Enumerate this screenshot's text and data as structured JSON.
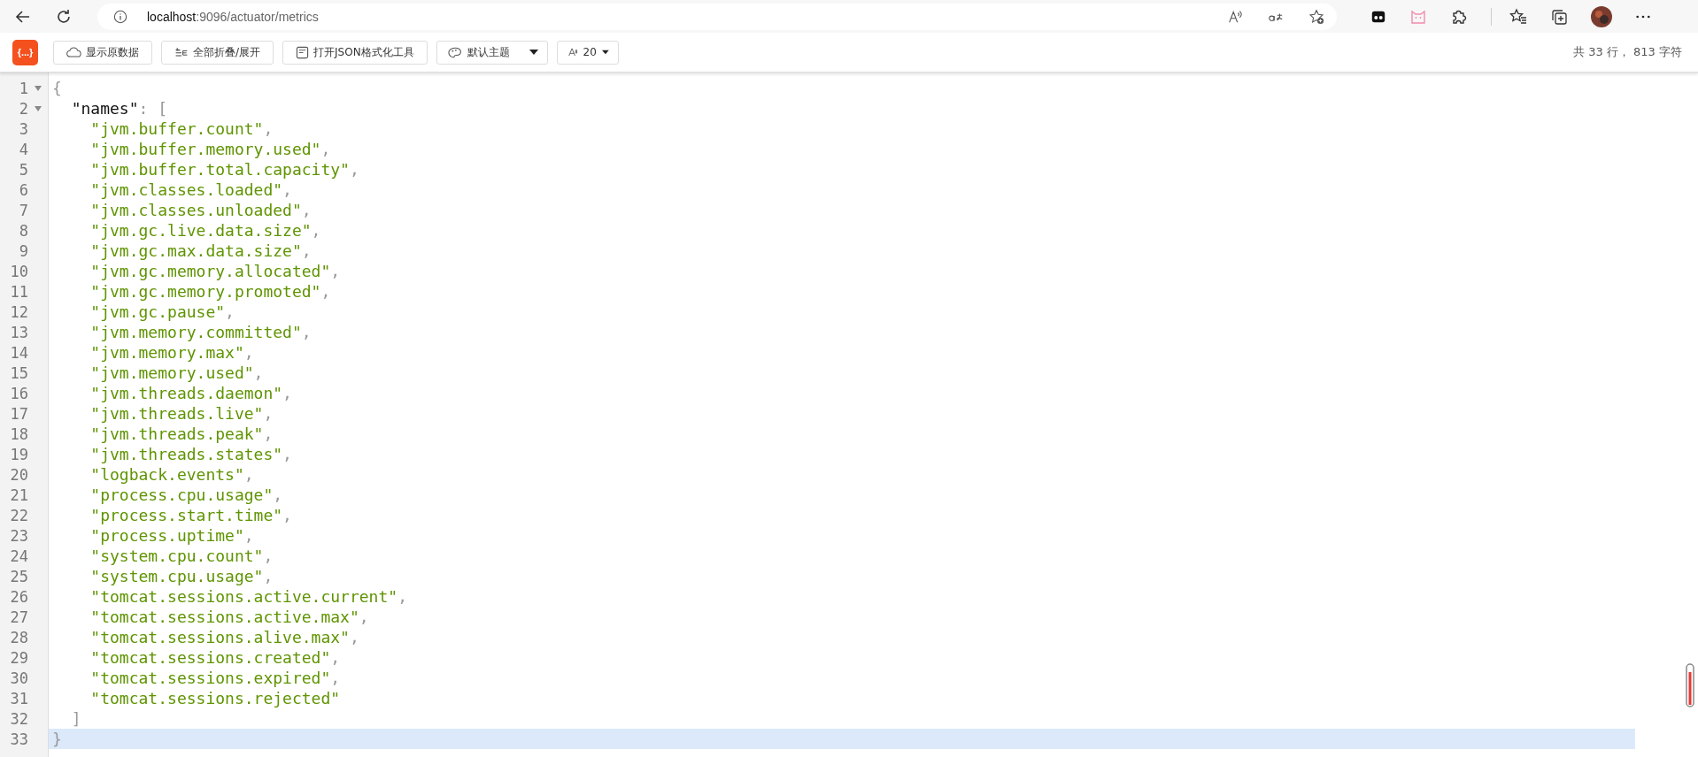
{
  "browser": {
    "url_host": "localhost",
    "url_path": ":9096/actuator/metrics"
  },
  "toolbar": {
    "logo": "{...}",
    "buttons": [
      {
        "kind": "raw",
        "label": "显示原数据"
      },
      {
        "kind": "fold",
        "label": "全部折叠/展开"
      },
      {
        "kind": "tool",
        "label": "打开JSON格式化工具"
      }
    ],
    "theme_select": {
      "value": "默认主题"
    },
    "font_select": {
      "value": "20"
    },
    "stats": "共 33 行， 813 字符"
  },
  "editor": {
    "lines": [
      {
        "number": "1",
        "foldable": true,
        "active": false,
        "tokens": [
          {
            "kind": "punct",
            "text": "{"
          }
        ]
      },
      {
        "number": "2",
        "foldable": true,
        "active": false,
        "tokens": [
          {
            "kind": "key",
            "text": "  \"names\""
          },
          {
            "kind": "punct",
            "text": ": ["
          }
        ]
      },
      {
        "number": "3",
        "foldable": false,
        "active": false,
        "tokens": [
          {
            "kind": "string",
            "text": "    \"jvm.buffer.count\""
          },
          {
            "kind": "punct",
            "text": ","
          }
        ]
      },
      {
        "number": "4",
        "foldable": false,
        "active": false,
        "tokens": [
          {
            "kind": "string",
            "text": "    \"jvm.buffer.memory.used\""
          },
          {
            "kind": "punct",
            "text": ","
          }
        ]
      },
      {
        "number": "5",
        "foldable": false,
        "active": false,
        "tokens": [
          {
            "kind": "string",
            "text": "    \"jvm.buffer.total.capacity\""
          },
          {
            "kind": "punct",
            "text": ","
          }
        ]
      },
      {
        "number": "6",
        "foldable": false,
        "active": false,
        "tokens": [
          {
            "kind": "string",
            "text": "    \"jvm.classes.loaded\""
          },
          {
            "kind": "punct",
            "text": ","
          }
        ]
      },
      {
        "number": "7",
        "foldable": false,
        "active": false,
        "tokens": [
          {
            "kind": "string",
            "text": "    \"jvm.classes.unloaded\""
          },
          {
            "kind": "punct",
            "text": ","
          }
        ]
      },
      {
        "number": "8",
        "foldable": false,
        "active": false,
        "tokens": [
          {
            "kind": "string",
            "text": "    \"jvm.gc.live.data.size\""
          },
          {
            "kind": "punct",
            "text": ","
          }
        ]
      },
      {
        "number": "9",
        "foldable": false,
        "active": false,
        "tokens": [
          {
            "kind": "string",
            "text": "    \"jvm.gc.max.data.size\""
          },
          {
            "kind": "punct",
            "text": ","
          }
        ]
      },
      {
        "number": "10",
        "foldable": false,
        "active": false,
        "tokens": [
          {
            "kind": "string",
            "text": "    \"jvm.gc.memory.allocated\""
          },
          {
            "kind": "punct",
            "text": ","
          }
        ]
      },
      {
        "number": "11",
        "foldable": false,
        "active": false,
        "tokens": [
          {
            "kind": "string",
            "text": "    \"jvm.gc.memory.promoted\""
          },
          {
            "kind": "punct",
            "text": ","
          }
        ]
      },
      {
        "number": "12",
        "foldable": false,
        "active": false,
        "tokens": [
          {
            "kind": "string",
            "text": "    \"jvm.gc.pause\""
          },
          {
            "kind": "punct",
            "text": ","
          }
        ]
      },
      {
        "number": "13",
        "foldable": false,
        "active": false,
        "tokens": [
          {
            "kind": "string",
            "text": "    \"jvm.memory.committed\""
          },
          {
            "kind": "punct",
            "text": ","
          }
        ]
      },
      {
        "number": "14",
        "foldable": false,
        "active": false,
        "tokens": [
          {
            "kind": "string",
            "text": "    \"jvm.memory.max\""
          },
          {
            "kind": "punct",
            "text": ","
          }
        ]
      },
      {
        "number": "15",
        "foldable": false,
        "active": false,
        "tokens": [
          {
            "kind": "string",
            "text": "    \"jvm.memory.used\""
          },
          {
            "kind": "punct",
            "text": ","
          }
        ]
      },
      {
        "number": "16",
        "foldable": false,
        "active": false,
        "tokens": [
          {
            "kind": "string",
            "text": "    \"jvm.threads.daemon\""
          },
          {
            "kind": "punct",
            "text": ","
          }
        ]
      },
      {
        "number": "17",
        "foldable": false,
        "active": false,
        "tokens": [
          {
            "kind": "string",
            "text": "    \"jvm.threads.live\""
          },
          {
            "kind": "punct",
            "text": ","
          }
        ]
      },
      {
        "number": "18",
        "foldable": false,
        "active": false,
        "tokens": [
          {
            "kind": "string",
            "text": "    \"jvm.threads.peak\""
          },
          {
            "kind": "punct",
            "text": ","
          }
        ]
      },
      {
        "number": "19",
        "foldable": false,
        "active": false,
        "tokens": [
          {
            "kind": "string",
            "text": "    \"jvm.threads.states\""
          },
          {
            "kind": "punct",
            "text": ","
          }
        ]
      },
      {
        "number": "20",
        "foldable": false,
        "active": false,
        "tokens": [
          {
            "kind": "string",
            "text": "    \"logback.events\""
          },
          {
            "kind": "punct",
            "text": ","
          }
        ]
      },
      {
        "number": "21",
        "foldable": false,
        "active": false,
        "tokens": [
          {
            "kind": "string",
            "text": "    \"process.cpu.usage\""
          },
          {
            "kind": "punct",
            "text": ","
          }
        ]
      },
      {
        "number": "22",
        "foldable": false,
        "active": false,
        "tokens": [
          {
            "kind": "string",
            "text": "    \"process.start.time\""
          },
          {
            "kind": "punct",
            "text": ","
          }
        ]
      },
      {
        "number": "23",
        "foldable": false,
        "active": false,
        "tokens": [
          {
            "kind": "string",
            "text": "    \"process.uptime\""
          },
          {
            "kind": "punct",
            "text": ","
          }
        ]
      },
      {
        "number": "24",
        "foldable": false,
        "active": false,
        "tokens": [
          {
            "kind": "string",
            "text": "    \"system.cpu.count\""
          },
          {
            "kind": "punct",
            "text": ","
          }
        ]
      },
      {
        "number": "25",
        "foldable": false,
        "active": false,
        "tokens": [
          {
            "kind": "string",
            "text": "    \"system.cpu.usage\""
          },
          {
            "kind": "punct",
            "text": ","
          }
        ]
      },
      {
        "number": "26",
        "foldable": false,
        "active": false,
        "tokens": [
          {
            "kind": "string",
            "text": "    \"tomcat.sessions.active.current\""
          },
          {
            "kind": "punct",
            "text": ","
          }
        ]
      },
      {
        "number": "27",
        "foldable": false,
        "active": false,
        "tokens": [
          {
            "kind": "string",
            "text": "    \"tomcat.sessions.active.max\""
          },
          {
            "kind": "punct",
            "text": ","
          }
        ]
      },
      {
        "number": "28",
        "foldable": false,
        "active": false,
        "tokens": [
          {
            "kind": "string",
            "text": "    \"tomcat.sessions.alive.max\""
          },
          {
            "kind": "punct",
            "text": ","
          }
        ]
      },
      {
        "number": "29",
        "foldable": false,
        "active": false,
        "tokens": [
          {
            "kind": "string",
            "text": "    \"tomcat.sessions.created\""
          },
          {
            "kind": "punct",
            "text": ","
          }
        ]
      },
      {
        "number": "30",
        "foldable": false,
        "active": false,
        "tokens": [
          {
            "kind": "string",
            "text": "    \"tomcat.sessions.expired\""
          },
          {
            "kind": "punct",
            "text": ","
          }
        ]
      },
      {
        "number": "31",
        "foldable": false,
        "active": false,
        "tokens": [
          {
            "kind": "string",
            "text": "    \"tomcat.sessions.rejected\""
          }
        ]
      },
      {
        "number": "32",
        "foldable": false,
        "active": false,
        "tokens": [
          {
            "kind": "punct",
            "text": "  ]"
          }
        ]
      },
      {
        "number": "33",
        "foldable": false,
        "active": true,
        "tokens": [
          {
            "kind": "punct",
            "text": "}"
          }
        ]
      }
    ]
  }
}
